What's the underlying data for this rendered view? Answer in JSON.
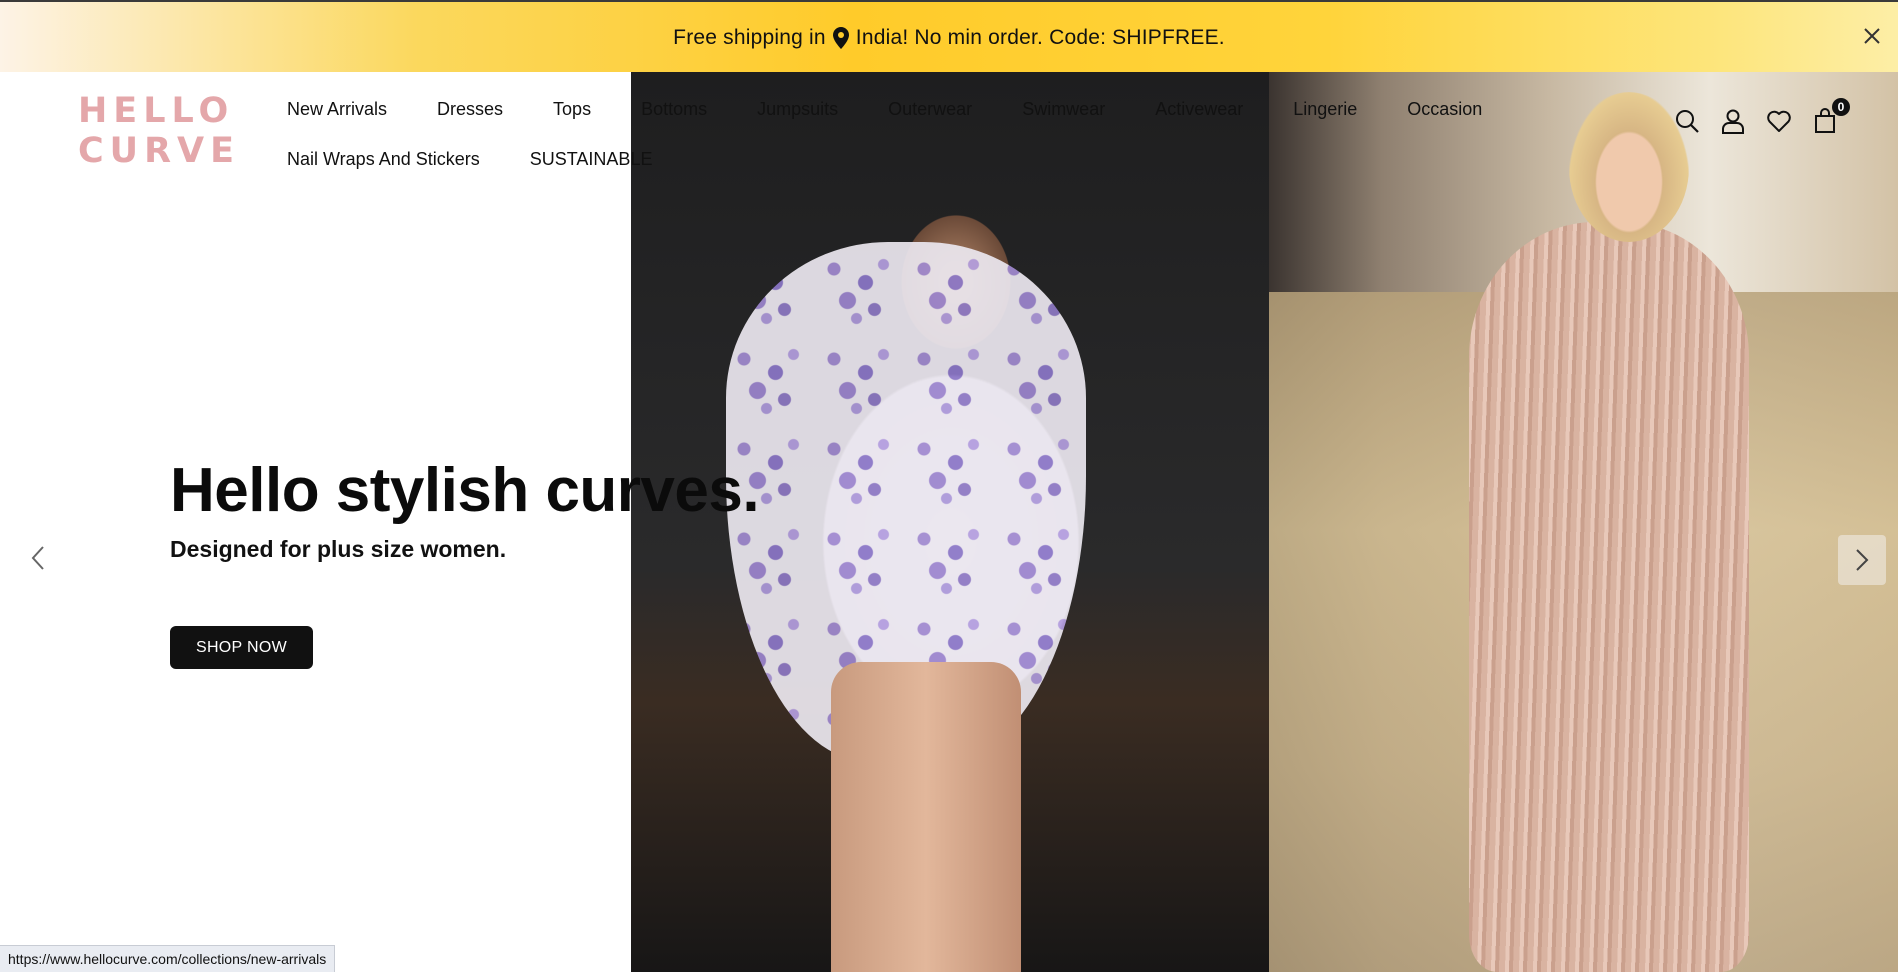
{
  "announcement": {
    "text_before": "Free shipping in",
    "text_after": "India! No min order. Code: SHIPFREE.",
    "pin_icon": "location-pin-icon",
    "close_icon": "close-icon"
  },
  "logo": {
    "line1": "HELLO",
    "line2": "CURVE",
    "color": "#e4a7aa"
  },
  "nav": {
    "row1": [
      "New Arrivals",
      "Dresses",
      "Tops",
      "Bottoms",
      "Jumpsuits",
      "Outerwear",
      "Swimwear",
      "Activewear",
      "Lingerie",
      "Occasion"
    ],
    "row2": [
      "Nail Wraps And Stickers",
      "SUSTAINABLE"
    ]
  },
  "header_icons": {
    "search": "search-icon",
    "account": "user-icon",
    "wishlist": "heart-icon",
    "cart": "shopping-bag-icon",
    "cart_count": "0"
  },
  "hero": {
    "title": "Hello stylish curves.",
    "subtitle": "Designed for plus size women.",
    "cta": "SHOP NOW"
  },
  "status_bar": {
    "url": "https://www.hellocurve.com/collections/new-arrivals"
  }
}
